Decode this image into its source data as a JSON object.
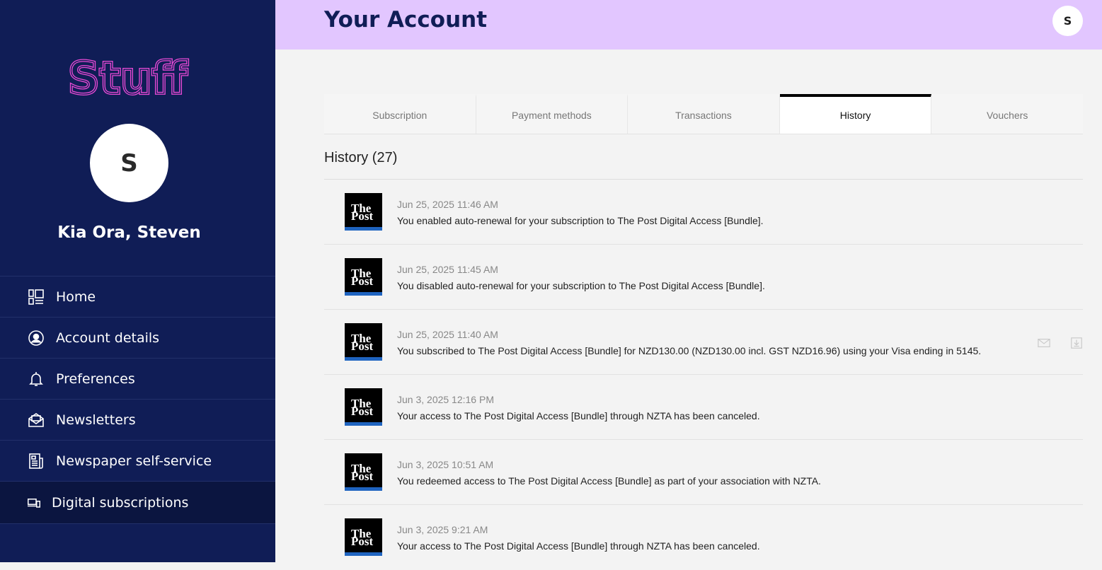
{
  "sidebar": {
    "logo_text": "Stuff",
    "avatar_initial": "S",
    "greeting": "Kia Ora, Steven",
    "items": [
      {
        "label": "Home",
        "icon": "home-layout-icon"
      },
      {
        "label": "Account details",
        "icon": "user-circle-icon"
      },
      {
        "label": "Preferences",
        "icon": "bell-icon"
      },
      {
        "label": "Newsletters",
        "icon": "envelope-open-icon"
      },
      {
        "label": "Newspaper self-service",
        "icon": "newspaper-icon"
      },
      {
        "label": "Digital subscriptions",
        "icon": "devices-icon",
        "active": true
      }
    ]
  },
  "header": {
    "title": "Your Account",
    "avatar_initial": "S"
  },
  "tabs": [
    {
      "label": "Subscription"
    },
    {
      "label": "Payment methods"
    },
    {
      "label": "Transactions"
    },
    {
      "label": "History",
      "active": true
    },
    {
      "label": "Vouchers"
    }
  ],
  "history": {
    "title": "History (27)",
    "thumb_line1": "The",
    "thumb_line2": "Post",
    "rows": [
      {
        "date": "Jun 25, 2025 11:46 AM",
        "text": "You enabled auto-renewal for your subscription to The Post Digital Access [Bundle]."
      },
      {
        "date": "Jun 25, 2025 11:45 AM",
        "text": "You disabled auto-renewal for your subscription to The Post Digital Access [Bundle]."
      },
      {
        "date": "Jun 25, 2025 11:40 AM",
        "text": "You subscribed to The Post Digital Access [Bundle] for NZD130.00 (NZD130.00 incl. GST NZD16.96) using your Visa ending in 5145."
      },
      {
        "date": "Jun 3, 2025 12:16 PM",
        "text": "Your access to The Post Digital Access [Bundle] through NZTA has been canceled."
      },
      {
        "date": "Jun 3, 2025 10:51 AM",
        "text": "You redeemed access to The Post Digital Access [Bundle] as part of your association with NZTA."
      },
      {
        "date": "Jun 3, 2025 9:21 AM",
        "text": "Your access to The Post Digital Access [Bundle] through NZTA has been canceled."
      }
    ]
  },
  "colors": {
    "sidebar_bg": "#101d56",
    "header_bg": "#e2c6ff",
    "logo": "#e94ad6",
    "thumb_accent": "#1f64c0"
  }
}
